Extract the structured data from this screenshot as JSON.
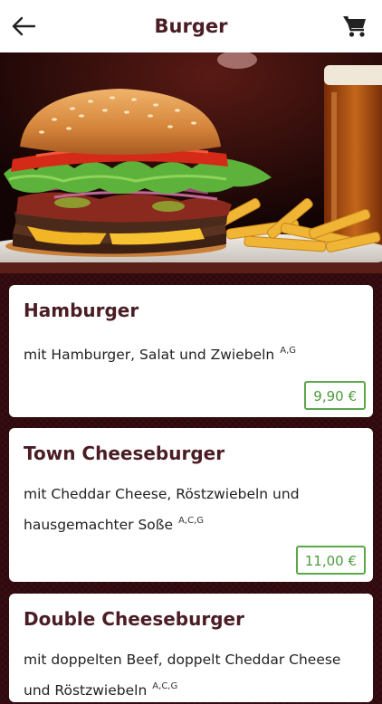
{
  "header": {
    "title": "Burger",
    "back_icon": "arrow-left-icon",
    "cart_icon": "shopping-cart-icon"
  },
  "hero": {
    "image": "burger-with-fries-and-beer-photo"
  },
  "colors": {
    "title": "#4a1d24",
    "background": "#3a0d12",
    "price_green": "#4d9b3e"
  },
  "items": [
    {
      "name": "Hamburger",
      "description": "mit Hamburger, Salat und Zwiebeln",
      "allergens": "A,G",
      "price": "9,90 €"
    },
    {
      "name": "Town Cheeseburger",
      "description": "mit Cheddar Cheese, Röstzwiebeln und hausgemachter Soße",
      "allergens": "A,C,G",
      "price": "11,00 €"
    },
    {
      "name": "Double Cheeseburger",
      "description": "mit doppelten Beef, doppelt Cheddar Cheese und Röstzwiebeln",
      "allergens": "A,C,G",
      "price": ""
    }
  ]
}
